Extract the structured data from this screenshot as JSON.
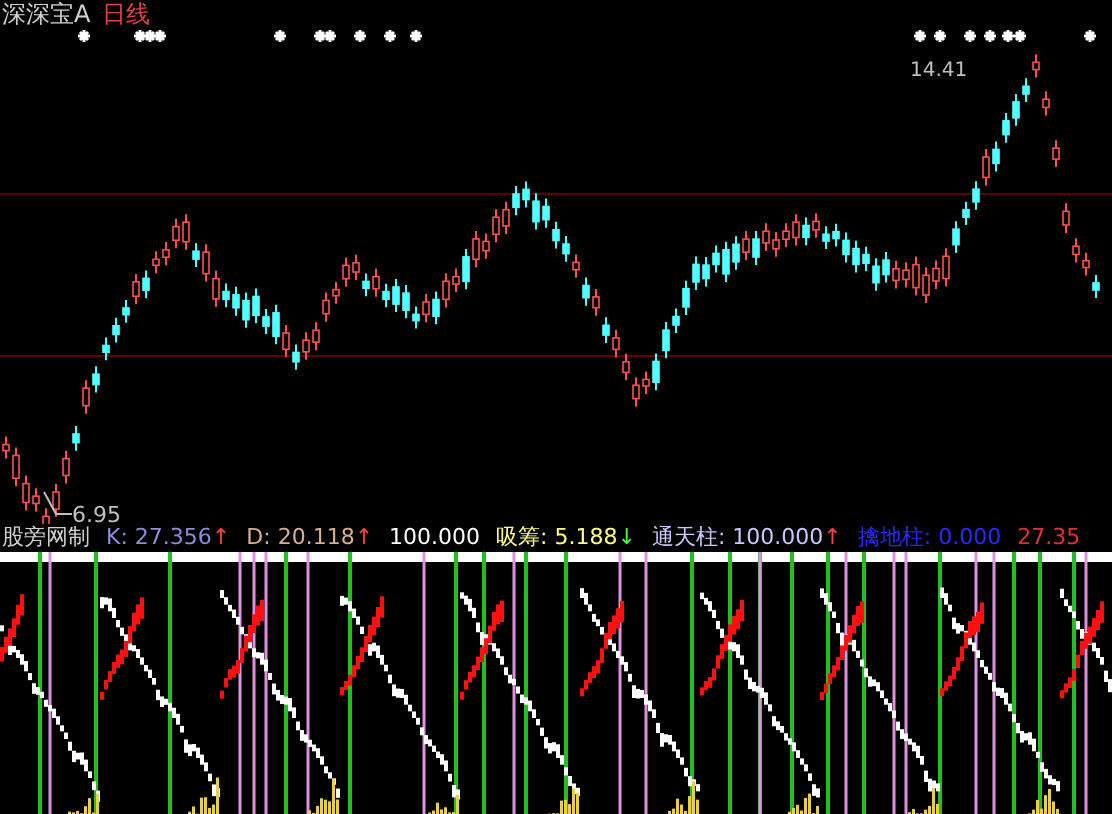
{
  "chart_title": {
    "name": "深深宝A",
    "period": "日线"
  },
  "price_panel": {
    "high_label": "14.41",
    "low_label": "6.95"
  },
  "indicator": {
    "name": "股旁网制",
    "readings": [
      {
        "label": "K:",
        "value": "27.356",
        "arrow": {
          "text": "↑",
          "color": "#ff4040"
        },
        "color": "#8c8cd8"
      },
      {
        "label": "D:",
        "value": "20.118",
        "arrow": {
          "text": "↑",
          "color": "#ff4040"
        },
        "color": "#d8b090"
      },
      {
        "value": "100.000",
        "color": "#ffffff"
      },
      {
        "label": "吸筹:",
        "value": "5.188",
        "arrow": {
          "text": "↓",
          "color": "#40ff40"
        },
        "color": "#ffff80"
      },
      {
        "label": "通天柱:",
        "value": "100.000",
        "arrow": {
          "text": "↑",
          "color": "#ff4040"
        },
        "color": "#c8c8ff"
      },
      {
        "label": "擒地柱:",
        "value": "0.000",
        "color": "#2828ff"
      },
      {
        "value": "27.35",
        "color": "#e03030"
      }
    ]
  }
}
